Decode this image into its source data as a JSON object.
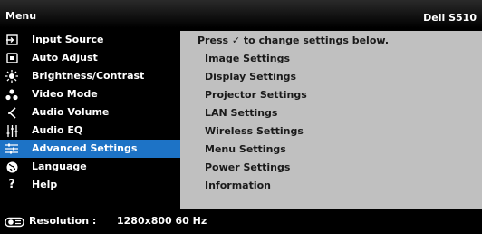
{
  "header": {
    "title": "Menu",
    "model": "Dell S510"
  },
  "menu": {
    "items": [
      {
        "label": "Input Source",
        "icon": "input-source-icon"
      },
      {
        "label": "Auto Adjust",
        "icon": "auto-adjust-icon"
      },
      {
        "label": "Brightness/Contrast",
        "icon": "brightness-icon"
      },
      {
        "label": "Video Mode",
        "icon": "video-mode-icon"
      },
      {
        "label": "Audio Volume",
        "icon": "speaker-icon"
      },
      {
        "label": "Audio EQ",
        "icon": "equalizer-icon"
      },
      {
        "label": "Advanced Settings",
        "icon": "sliders-icon",
        "selected": true
      },
      {
        "label": "Language",
        "icon": "globe-icon"
      },
      {
        "label": "Help",
        "icon": "question-icon"
      }
    ]
  },
  "panel": {
    "hint": "Press ✓ to change settings below.",
    "items": [
      "Image Settings",
      "Display Settings",
      "Projector Settings",
      "LAN Settings",
      "Wireless Settings",
      "Menu Settings",
      "Power Settings",
      "Information"
    ]
  },
  "status": {
    "label": "Resolution :",
    "value": "1280x800 60 Hz",
    "icon": "projector-icon"
  },
  "colors": {
    "highlight": "#1d73c6",
    "panel_bg": "#c0c0c0",
    "background": "#000000"
  }
}
